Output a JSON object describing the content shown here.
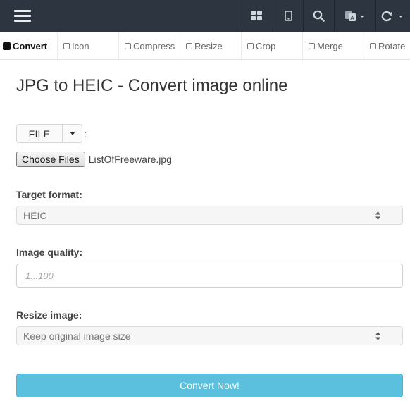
{
  "nav": {
    "buttons": [
      {
        "icon": "grid-icon"
      },
      {
        "icon": "tablet-icon"
      },
      {
        "icon": "search-icon"
      },
      {
        "icon": "translate-icon"
      },
      {
        "icon": "refresh-icon"
      }
    ]
  },
  "tabs": [
    {
      "label": "Convert",
      "active": true
    },
    {
      "label": "Icon",
      "active": false
    },
    {
      "label": "Compress",
      "active": false
    },
    {
      "label": "Resize",
      "active": false
    },
    {
      "label": "Crop",
      "active": false
    },
    {
      "label": "Merge",
      "active": false
    },
    {
      "label": "Rotate",
      "active": false
    }
  ],
  "page": {
    "title": "JPG to HEIC - Convert image online"
  },
  "source": {
    "type_button": "FILE",
    "colon": ":",
    "choose_files": "Choose Files",
    "file_name": "ListOfFreeware.jpg"
  },
  "form": {
    "target_format_label": "Target format:",
    "target_format_value": "HEIC",
    "image_quality_label": "Image quality:",
    "image_quality_placeholder": "1...100",
    "resize_label": "Resize image:",
    "resize_value": "Keep original image size",
    "submit": "Convert Now!"
  },
  "colors": {
    "topbar": "#2c3540",
    "accent": "#5bc0de"
  }
}
